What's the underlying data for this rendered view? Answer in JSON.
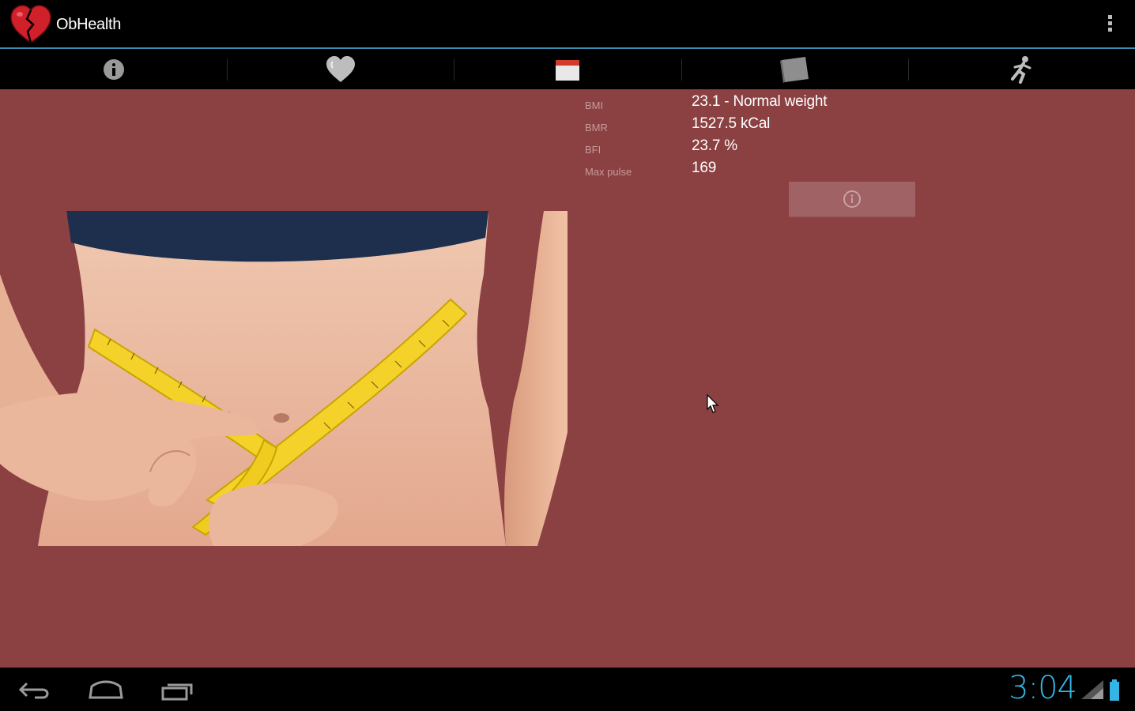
{
  "app": {
    "title": "ObHealth",
    "icon": "broken-heart-icon",
    "menu_icon": "overflow-menu-icon"
  },
  "tabs": [
    {
      "icon": "info-icon"
    },
    {
      "icon": "heart-icon"
    },
    {
      "icon": "calendar-icon"
    },
    {
      "icon": "notebook-icon"
    },
    {
      "icon": "running-man-icon"
    }
  ],
  "stats": {
    "bmi": {
      "label": "BMI",
      "value": "23.1 - Normal weight"
    },
    "bmr": {
      "label": "BMR",
      "value": "1527.5 kCal"
    },
    "bfi": {
      "label": "BFI",
      "value": "23.7 %"
    },
    "pulse": {
      "label": "Max pulse",
      "value": "169"
    }
  },
  "info_button": {
    "icon": "info-circle-icon"
  },
  "photo": {
    "description_icon": "waist-measuring-tape-photo"
  },
  "nav": {
    "back_icon": "back-icon",
    "home_icon": "home-icon",
    "recents_icon": "recent-apps-icon"
  },
  "status": {
    "time": "3:04",
    "icons": [
      "signal-icon",
      "battery-icon"
    ]
  },
  "colors": {
    "content_bg": "#8b4042",
    "accent": "#35b5e5",
    "action_bar_divider": "#3a8fb0"
  }
}
